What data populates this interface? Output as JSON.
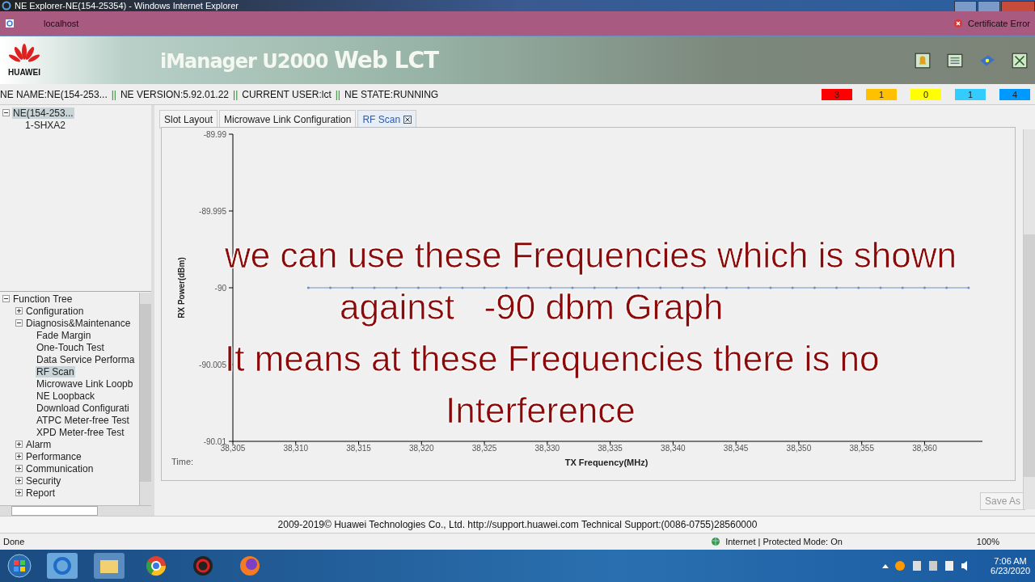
{
  "window": {
    "title": "NE Explorer-NE(154-25354) - Windows Internet Explorer"
  },
  "address_bar": {
    "host": "localhost",
    "certificate": "Certificate Error"
  },
  "header": {
    "logo": "HUAWEI",
    "title": "iManager U2000",
    "title_bold": "Web LCT"
  },
  "info_bar": {
    "segments": [
      "NE NAME:NE(154-253...",
      "NE VERSION:5.92.01.22",
      "CURRENT USER:lct",
      "NE STATE:RUNNING"
    ],
    "separator": "||"
  },
  "alarm_counts": [
    {
      "count": "3",
      "color": "#ff0000"
    },
    {
      "count": "1",
      "color": "#ffc000"
    },
    {
      "count": "0",
      "color": "#ffff00"
    },
    {
      "count": "1",
      "color": "#33ccff"
    },
    {
      "count": "4",
      "color": "#0099ff"
    }
  ],
  "ne_tree": [
    {
      "label": "NE(154-253...",
      "expanded": true,
      "selected": true,
      "children": [
        {
          "label": "1-SHXA2",
          "selected": false
        }
      ]
    }
  ],
  "function_tree": {
    "title": "Function Tree",
    "items": [
      {
        "label": "Configuration",
        "expanded": false,
        "selected": false
      },
      {
        "label": "Diagnosis&Maintenance",
        "expanded": true,
        "selected": false,
        "children": [
          {
            "label": "Fade Margin",
            "selected": false
          },
          {
            "label": "One-Touch Test",
            "selected": false
          },
          {
            "label": "Data Service Performa",
            "selected": false
          },
          {
            "label": "RF Scan",
            "selected": true
          },
          {
            "label": "Microwave Link Loopb",
            "selected": false
          },
          {
            "label": "NE Loopback",
            "selected": false
          },
          {
            "label": "Download Configurati",
            "selected": false
          },
          {
            "label": "ATPC Meter-free Test",
            "selected": false
          },
          {
            "label": "XPD Meter-free Test",
            "selected": false
          }
        ]
      },
      {
        "label": "Alarm",
        "expanded": false,
        "selected": false
      },
      {
        "label": "Performance",
        "expanded": false,
        "selected": false
      },
      {
        "label": "Communication",
        "expanded": false,
        "selected": false
      },
      {
        "label": "Security",
        "expanded": false,
        "selected": false
      },
      {
        "label": "Report",
        "expanded": false,
        "selected": false
      }
    ]
  },
  "tabs": [
    {
      "label": "Slot Layout",
      "selected": false
    },
    {
      "label": "Microwave Link Configuration",
      "selected": false
    },
    {
      "label": "RF Scan",
      "selected": true,
      "closable": true
    }
  ],
  "chart": {
    "time_label": "Time:",
    "chart_data": {
      "type": "line",
      "xlabel": "TX Frequency(MHz)",
      "ylabel": "RX Power(dBm)",
      "x": [
        38311,
        38312.75,
        38314.5,
        38316.25,
        38318,
        38319.75,
        38321.5,
        38323.25,
        38325,
        38326.75,
        38328.5,
        38330.25,
        38332,
        38333.75,
        38335.5,
        38337.25,
        38339,
        38340.75,
        38342.5,
        38344.25,
        38346,
        38347.75,
        38349.5,
        38351.25,
        38353,
        38354.75,
        38356.5,
        38358.25,
        38360,
        38361.75,
        38363.5
      ],
      "series": [
        {
          "color": "#6f8fc0",
          "values": [
            -90,
            -90,
            -90,
            -90,
            -90,
            -90,
            -90,
            -90,
            -90,
            -90,
            -90,
            -90,
            -90,
            -90,
            -90,
            -90,
            -90,
            -90,
            -90,
            -90,
            -90,
            -90,
            -90,
            -90,
            -90,
            -90,
            -90,
            -90,
            -90,
            -90,
            -90
          ]
        }
      ],
      "xlim": [
        38305,
        38364.6
      ],
      "ylim": [
        -90.01,
        -89.99
      ],
      "xticks": [
        {
          "value": 38305,
          "label": "38,305"
        },
        {
          "value": 38310,
          "label": "38,310"
        },
        {
          "value": 38315,
          "label": "38,315"
        },
        {
          "value": 38320,
          "label": "38,320"
        },
        {
          "value": 38325,
          "label": "38,325"
        },
        {
          "value": 38330,
          "label": "38,330"
        },
        {
          "value": 38335,
          "label": "38,335"
        },
        {
          "value": 38340,
          "label": "38,340"
        },
        {
          "value": 38345,
          "label": "38,345"
        },
        {
          "value": 38350,
          "label": "38,350"
        },
        {
          "value": 38355,
          "label": "38,355"
        },
        {
          "value": 38360,
          "label": "38,360"
        }
      ],
      "yticks": [
        -89.99,
        -89.995,
        -90,
        -90.005,
        -90.01
      ]
    }
  },
  "caption": [
    "we can use these Frequencies which is shown",
    "against   -90 dbm Graph",
    "It means at these Frequencies there is no",
    "Interference"
  ],
  "save_button": "Save As",
  "footer": "2009-2019© Huawei Technologies Co., Ltd. http://support.huawei.com Technical Support:(0086-0755)28560000",
  "ie_status": {
    "left": "Done",
    "zone": "Internet | Protected Mode: On",
    "zoom": "100%"
  },
  "taskbar": {
    "time": "7:06 AM",
    "date": "6/23/2020"
  }
}
